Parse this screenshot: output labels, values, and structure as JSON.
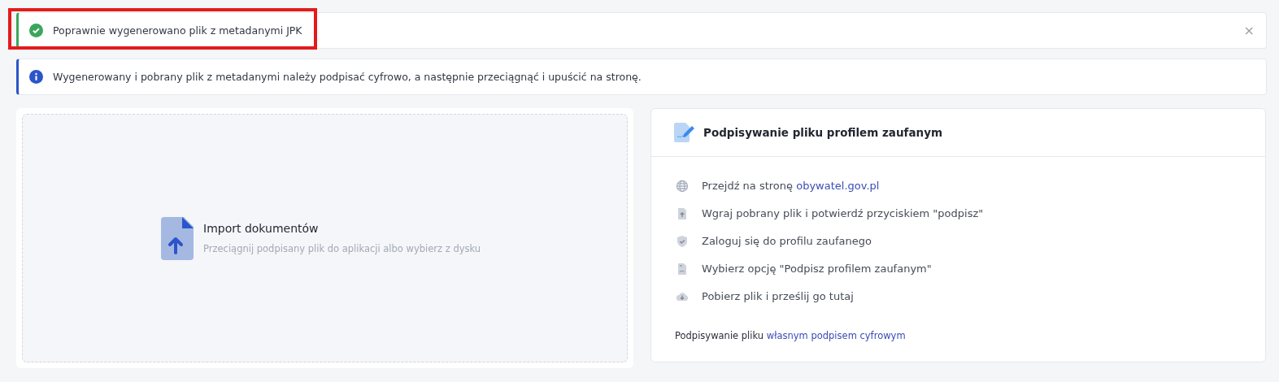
{
  "alerts": [
    {
      "kind": "success",
      "text": "Poprawnie wygenerowano plik z metadanymi JPK",
      "close": "×",
      "highlighted": true
    },
    {
      "kind": "info",
      "text": "Wygenerowany i pobrany plik z metadanymi należy podpisać cyfrowo, a następnie przeciągnąć i upuścić na stronę.",
      "highlighted": false
    }
  ],
  "dropzone": {
    "title": "Import dokumentów",
    "hint": "Przeciągnij podpisany plik do aplikacji albo wybierz z dysku"
  },
  "signing_card": {
    "title": "Podpisywanie pliku profilem zaufanym",
    "steps": [
      {
        "kind": "globe",
        "text": "Przejdź na stronę ",
        "link": "obywatel.gov.pl"
      },
      {
        "kind": "upload",
        "text": "Wgraj pobrany plik i potwierdź przyciskiem \"podpisz\""
      },
      {
        "kind": "shield",
        "text": "Zaloguj się do profilu zaufanego"
      },
      {
        "kind": "file",
        "text": "Wybierz opcję \"Podpisz profilem zaufanym\""
      },
      {
        "kind": "cloud",
        "text": "Pobierz plik i prześlij go tutaj"
      }
    ],
    "footer": {
      "text": "Podpisywanie pliku ",
      "link": "własnym podpisem cyfrowym"
    }
  }
}
